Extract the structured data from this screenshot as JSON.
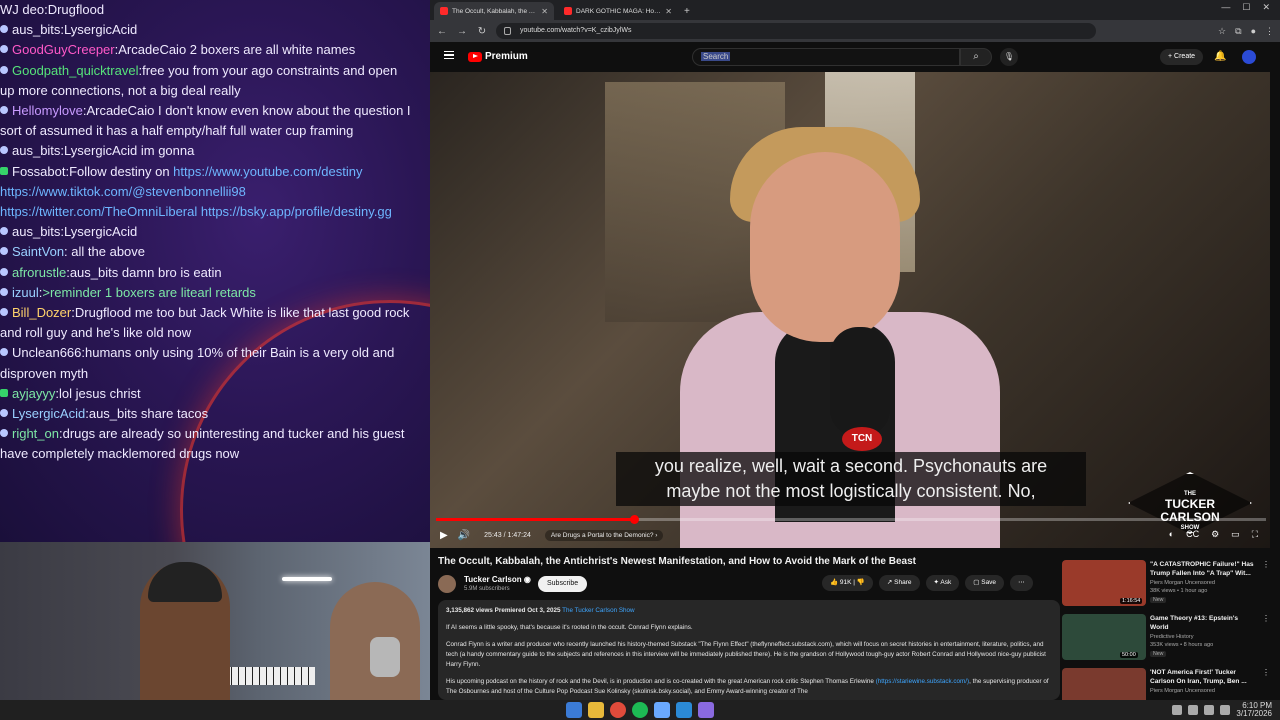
{
  "colors": {
    "youtube_red": "#ff0000",
    "chat_bg": "#2a1654",
    "link": "#3ea6ff",
    "chat_link": "#6eb6ff"
  },
  "chat": {
    "messages": [
      {
        "user": "WJ deo",
        "color": "#efeaff",
        "text": "Drugflood",
        "badge": "none"
      },
      {
        "user": "aus_bits",
        "color": "#efeaff",
        "text": "LysergicAcid",
        "badge": "dot"
      },
      {
        "user": "GoodGuyCreeper",
        "color": "#ff59c8",
        "text": "ArcadeCaio 2 boxers are all white names",
        "badge": "dot"
      },
      {
        "user": "Goodpath_quicktravel",
        "color": "#56e37a",
        "text": "free you from your ago constraints and open up more connections, not a big deal really",
        "badge": "dot"
      },
      {
        "user": "Hellomylove",
        "color": "#c89bff",
        "text": "ArcadeCaio I don't know even know about the question  I sort of assumed it has a half empty/half full water cup framing",
        "badge": "dot"
      },
      {
        "user": "aus_bits",
        "color": "#efeaff",
        "text": "LysergicAcid im gonna",
        "badge": "dot"
      },
      {
        "user": "Fossabot",
        "color": "#efeaff",
        "text": "Follow destiny on ",
        "badge": "bot",
        "links": [
          "https://www.youtube.com/destiny",
          "https://www.tiktok.com/@stevenbonnellii98",
          "https://twitter.com/TheOmniLiberal",
          "https://bsky.app/profile/destiny.gg"
        ]
      },
      {
        "user": "aus_bits",
        "color": "#efeaff",
        "text": "LysergicAcid",
        "badge": "dot"
      },
      {
        "user": "SaintVon",
        "color": "#9ad0ff",
        "text": " all the above",
        "badge": "dot"
      },
      {
        "user": "afrorustle",
        "color": "#7ee8a6",
        "text": "aus_bits damn bro is eatin",
        "badge": "dot"
      },
      {
        "user": "izuul",
        "color": "#9ad0ff",
        "text": ">reminder 1 boxers are litearl retards",
        "badge": "dot",
        "greentext": true
      },
      {
        "user": "Bill_Dozer",
        "color": "#ffd36b",
        "text": "Drugflood me too  but Jack White is like that last good rock and roll guy and he's like old now",
        "badge": "dot"
      },
      {
        "user": "Unclean666",
        "color": "#efeaff",
        "text": "humans only using 10% of their Bain is a very old and disproven myth",
        "badge": "dot"
      },
      {
        "user": "ayjayyy",
        "color": "#7ee8a6",
        "text": "lol jesus christ",
        "badge": "bot"
      },
      {
        "user": "LysergicAcid",
        "color": "#9ad0ff",
        "text": "aus_bits  share tacos",
        "badge": "dot"
      },
      {
        "user": "right_on",
        "color": "#7ee8a6",
        "text": "drugs are already so uninteresting and tucker and his guest have completely macklemored drugs now",
        "badge": "dot"
      }
    ]
  },
  "browser": {
    "tabs": [
      {
        "title": "The Occult, Kabbalah, the A...",
        "active": true
      },
      {
        "title": "DARK GOTHIC MAGA: How Tec...",
        "active": false
      }
    ],
    "url": "youtube.com/watch?v=K_czibJylWs"
  },
  "youtube": {
    "logo_text": "Premium",
    "search_placeholder": "Search",
    "create_label": "Create",
    "captions_line1": "you realize, well, wait a second. Psychonauts are",
    "captions_line2": "maybe not the most logistically consistent. No,",
    "watermark_line1": "THE",
    "watermark_line2": "TUCKER",
    "watermark_line3": "CARLSON",
    "watermark_line4": "SHOW",
    "tcn_label": "TCN",
    "progress_fraction": 0.239,
    "time_display": "25:43 / 1:47:24",
    "chapter": "Are Drugs a Portal to the Demonic?",
    "video_title": "The Occult, Kabbalah, the Antichrist's Newest Manifestation, and How to Avoid the Mark of the Beast",
    "channel_name": "Tucker Carlson",
    "subscribers": "5.9M subscribers",
    "subscribe_label": "Subscribe",
    "likes": "91K",
    "share_label": "Share",
    "ask_label": "Ask",
    "save_label": "Save",
    "description": {
      "meta": "3,135,862 views  Premiered Oct 3, 2025",
      "meta_link": "The Tucker Carlson Show",
      "p1": "If AI seems a little spooky, that's because it's rooted in the occult. Conrad Flynn explains.",
      "p2": "Conrad Flynn is a writer and producer who recently launched his history-themed Substack \"The Flynn Effect\" (theflynneffect.substack.com), which will focus on secret histories in entertainment, literature, politics, and tech (a handy commentary guide to the subjects and references in this interview will be immediately published there). He is the grandson of Hollywood tough-guy actor Robert Conrad and Hollywood nice-guy publicist Harry Flynn.",
      "p3": "His upcoming podcast on the history of rock and the Devil, is in production and is co-created with the great American rock critic Stephen Thomas Erlewine",
      "p3_link": "(https://stariewine.substack.com/)",
      "p3_rest": ", the supervising producer of The Osbournes and host of the Culture Pop Podcast Sue Kolinsky (skolinsk.bsky.social), and Emmy Award-winning creator of The"
    },
    "recommendations": [
      {
        "title": "\"A CATASTROPHIC Failure!\" Has Trump Fallen Into \"A Trap\" Wit...",
        "channel": "Piers Morgan Uncensored",
        "meta": "38K views • 1 hour ago",
        "badge": "New",
        "duration": "1:16:54",
        "thumb": "#9a3a2a"
      },
      {
        "title": "Game Theory #13: Epstein's World",
        "channel": "Predictive History",
        "meta": "353K views • 8 hours ago",
        "badge": "New",
        "duration": "50:00",
        "thumb": "#2d4a3a"
      },
      {
        "title": "'NOT America First!' Tucker Carlson On Iran, Trump, Ben ...",
        "channel": "Piers Morgan Uncensored",
        "meta": "",
        "badge": "",
        "duration": "",
        "thumb": "#7a3a2e"
      }
    ]
  },
  "taskbar": {
    "time": "6:10 PM",
    "date": "3/17/2026"
  }
}
